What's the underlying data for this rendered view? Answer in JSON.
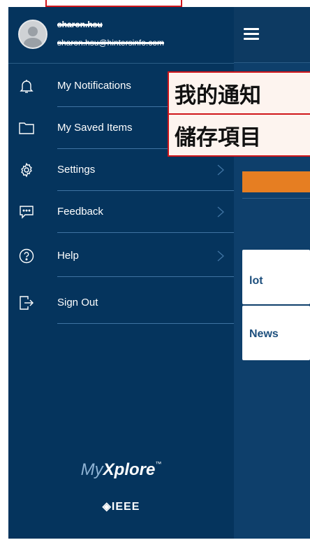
{
  "user": {
    "name": "sharon.hsu",
    "email": "sharon.hsu@hintersinfo.com"
  },
  "menu": {
    "items": [
      {
        "label": "My Notifications",
        "icon": "bell-icon"
      },
      {
        "label": "My Saved Items",
        "icon": "folder-icon"
      },
      {
        "label": "Settings",
        "icon": "gear-icon"
      },
      {
        "label": "Feedback",
        "icon": "feedback-icon"
      },
      {
        "label": "Help",
        "icon": "help-icon"
      },
      {
        "label": "Sign Out",
        "icon": "sign-out-icon"
      }
    ]
  },
  "branding": {
    "my": "My",
    "xplore": "Xplore",
    "tm": "™",
    "ieee": "◈IEEE"
  },
  "background_page": {
    "cards": [
      "lot",
      "News"
    ]
  },
  "annotations": [
    "我的通知",
    "儲存項目"
  ],
  "colors": {
    "drawer_bg": "#05345d",
    "page_bg": "#0e3f6b",
    "accent_orange": "#e67e22",
    "annotation_border": "#d0161b"
  }
}
